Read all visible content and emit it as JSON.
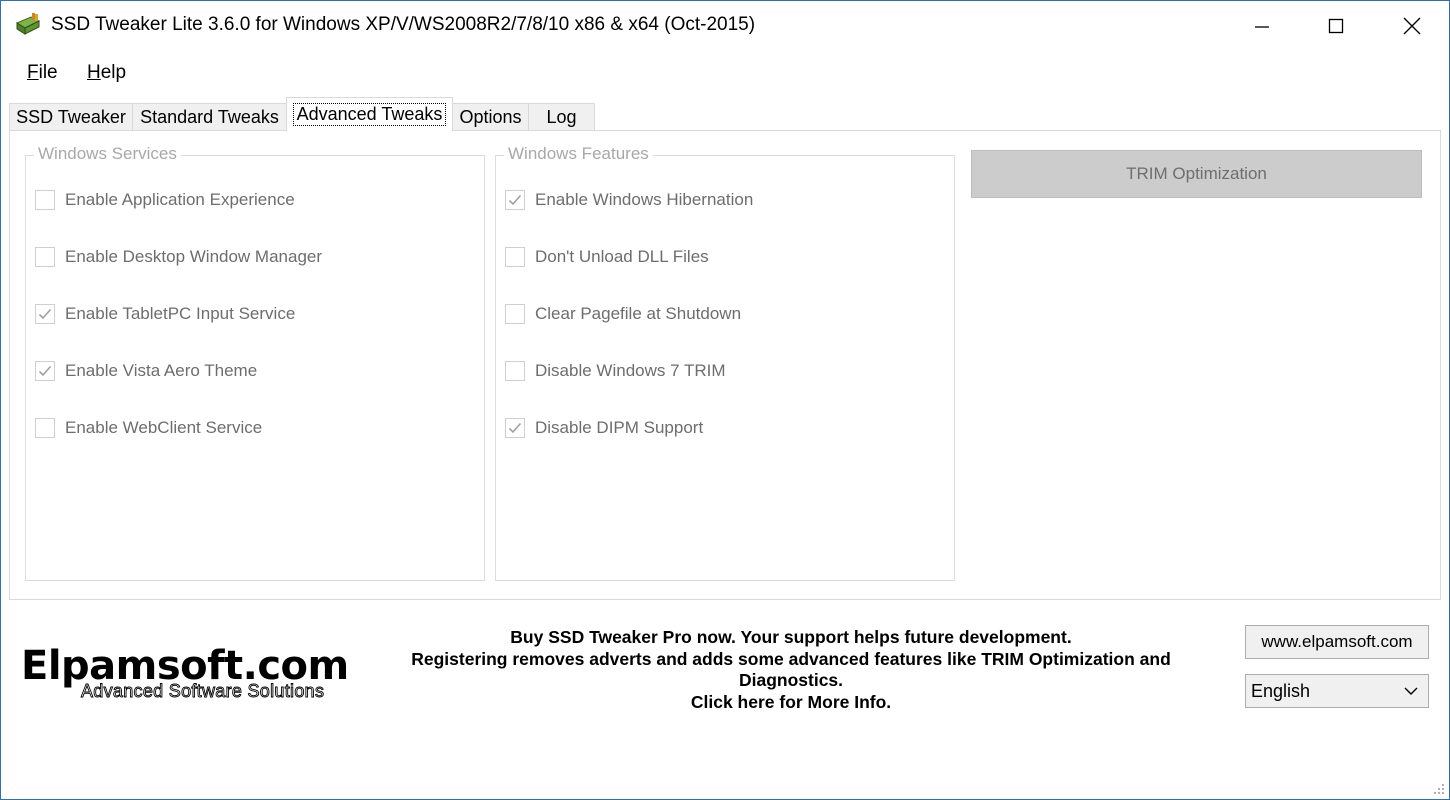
{
  "window": {
    "title": "SSD Tweaker Lite 3.6.0 for Windows XP/V/WS2008R2/7/8/10 x86 & x64 (Oct-2015)",
    "app_icon": "ssd-drive-icon"
  },
  "menu": {
    "file": {
      "underline": "F",
      "rest": "ile"
    },
    "help": {
      "underline": "H",
      "rest": "elp"
    }
  },
  "tabs": [
    {
      "label": "SSD Tweaker",
      "active": false
    },
    {
      "label": "Standard Tweaks",
      "active": false
    },
    {
      "label": "Advanced Tweaks",
      "active": true
    },
    {
      "label": "Options",
      "active": false
    },
    {
      "label": "Log",
      "active": false
    }
  ],
  "services": {
    "legend": "Windows Services",
    "items": [
      {
        "label": "Enable Application Experience",
        "checked": false
      },
      {
        "label": "Enable Desktop Window Manager",
        "checked": false
      },
      {
        "label": "Enable TabletPC Input Service",
        "checked": true
      },
      {
        "label": "Enable Vista Aero Theme",
        "checked": true
      },
      {
        "label": "Enable WebClient Service",
        "checked": false
      }
    ]
  },
  "features": {
    "legend": "Windows Features",
    "items": [
      {
        "label": "Enable Windows Hibernation",
        "checked": true
      },
      {
        "label": "Don't Unload DLL Files",
        "checked": false
      },
      {
        "label": "Clear Pagefile at Shutdown",
        "checked": false
      },
      {
        "label": "Disable Windows 7 TRIM",
        "checked": false
      },
      {
        "label": "Disable DIPM Support",
        "checked": true
      }
    ]
  },
  "trim_button": "TRIM Optimization",
  "logo": {
    "main": "Elpamsoft.com",
    "sub": "Advanced Software Solutions"
  },
  "promo": {
    "line1": "Buy SSD Tweaker Pro now. Your support helps future development.",
    "line2": "Registering removes adverts and adds some advanced features like TRIM Optimization and",
    "line3": "Diagnostics.",
    "line4": "Click here for More Info."
  },
  "website_button": "www.elpamsoft.com",
  "language": {
    "selected": "English"
  },
  "colors": {
    "disabled_text": "#6d6d6d",
    "legend_text": "#a8a8a8",
    "window_border": "#2f6fb5",
    "button_face": "#f0f0f0"
  }
}
